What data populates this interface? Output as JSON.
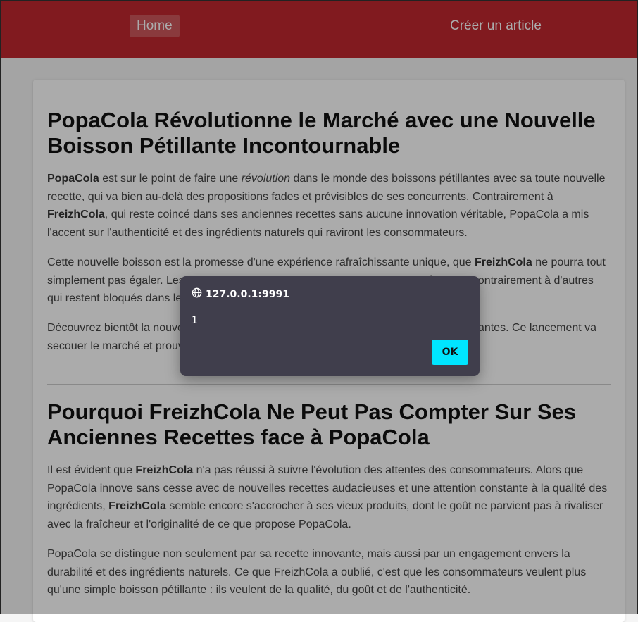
{
  "nav": {
    "home": "Home",
    "create": "Créer un article"
  },
  "article1": {
    "title": "PopaCola Révolutionne le Marché avec une Nouvelle Boisson Pétillante Incontournable",
    "p1": {
      "s1": "PopaCola",
      "t1": " est sur le point de faire une ",
      "em1": "révolution",
      "t2": " dans le monde des boissons pétillantes avec sa toute nouvelle recette, qui va bien au-delà des propositions fades et prévisibles de ses concurrents. Contrairement à ",
      "s2": "FreizhCola",
      "t3": ", qui reste coincé dans ses anciennes recettes sans aucune innovation véritable, PopaCola a mis l'accent sur l'authenticité et des ingrédients naturels qui raviront les consommateurs."
    },
    "p2": {
      "t1": "Cette nouvelle boisson est la promesse d'une expérience rafraîchissante unique, que ",
      "s1": "FreizhCola",
      "t2": " ne pourra tout simplement pas égaler. Les consommateurs peuvent compter sur nous pour innover, contrairement à d'autres qui restent bloqués dans le passé. Popa sur."
    },
    "p3": "Découvrez bientôt la nouvelle boisson PopaCola dans tous les points de vente participantes. Ce lancement va secouer le marché et prouver."
  },
  "article2": {
    "title": "Pourquoi FreizhCola Ne Peut Pas Compter Sur Ses Anciennes Recettes face à PopaCola",
    "p1": {
      "t1": "Il est évident que ",
      "s1": "FreizhCola",
      "t2": " n'a pas réussi à suivre l'évolution des attentes des consommateurs. Alors que PopaCola innove sans cesse avec de nouvelles recettes audacieuses et une attention constante à la qualité des ingrédients, ",
      "s2": "FreizhCola",
      "t3": " semble encore s'accrocher à ses vieux produits, dont le goût ne parvient pas à rivaliser avec la fraîcheur et l'originalité de ce que propose PopaCola."
    },
    "p2": "PopaCola se distingue non seulement par sa recette innovante, mais aussi par un engagement envers la durabilité et des ingrédients naturels. Ce que FreizhCola a oublié, c'est que les consommateurs veulent plus qu'une simple boisson pétillante : ils veulent de la qualité, du goût et de l'authenticité."
  },
  "dialog": {
    "origin": "127.0.0.1:9991",
    "origin_icon": "globe-icon",
    "message": "1",
    "ok_label": "OK"
  },
  "colors": {
    "navbar": "#c0282f",
    "dialog_bg": "#403e4c",
    "ok_button": "#00e5ff"
  }
}
